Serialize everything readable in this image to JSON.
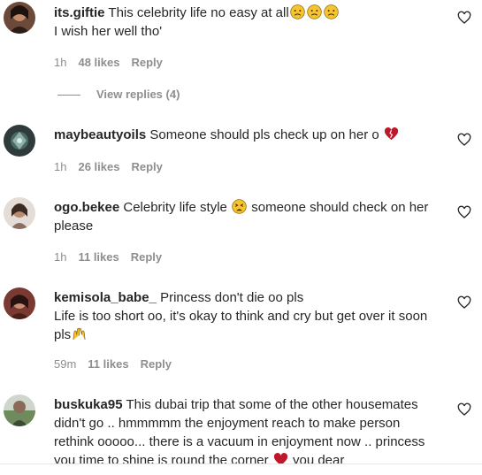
{
  "comments": [
    {
      "username": "its.giftie",
      "text_a": "This celebrity life no easy at all",
      "text_b": "I wish her well tho'",
      "time": "1h",
      "likes": "48 likes",
      "reply": "Reply",
      "view_replies": "View replies (4)"
    },
    {
      "username": "maybeautyoils",
      "text_a": "Someone should pls check up on her o",
      "time": "1h",
      "likes": "26 likes",
      "reply": "Reply"
    },
    {
      "username": "ogo.bekee",
      "text_a": "Celebrity life style",
      "text_b": "someone should check on her please",
      "time": "1h",
      "likes": "11 likes",
      "reply": "Reply"
    },
    {
      "username": "kemisola_babe_",
      "text_a": "Princess don't die oo pls",
      "text_b": "Life is too short oo, it's okay to think and cry but get over it soon pls",
      "time": "59m",
      "likes": "11 likes",
      "reply": "Reply"
    },
    {
      "username": "buskuka95",
      "text_a": "This dubai trip that some of the other housemates didn't go .. hmmmmm the enjoyment reach to make person rethink ooooo... there is a vacuum in enjoyment now .. princess you time to shine is round the corner",
      "text_b": "you dear"
    }
  ],
  "colors": {
    "username": "#262626",
    "meta": "#8e8e8e",
    "heart_red": "#c0182b"
  },
  "icons": [
    "heart-outline-icon",
    "sad-face-emoji",
    "broken-heart-emoji",
    "tired-face-emoji",
    "raised-hands-emoji",
    "red-heart-emoji"
  ]
}
